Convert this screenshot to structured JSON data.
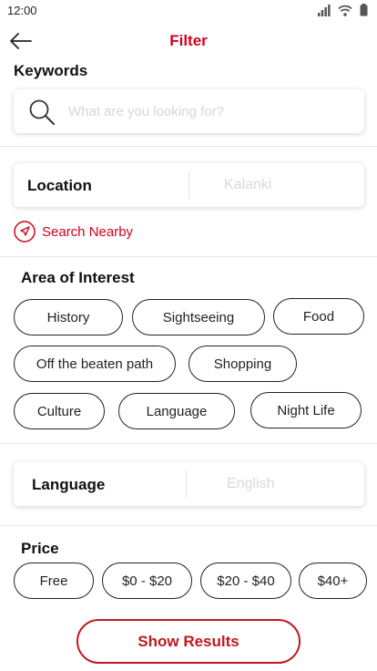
{
  "status_bar": {
    "time": "12:00"
  },
  "header": {
    "title": "Filter"
  },
  "keywords": {
    "label": "Keywords",
    "value": "",
    "placeholder": "What are you looking for?"
  },
  "location": {
    "label": "Location",
    "value": "Kalanki"
  },
  "search_nearby": {
    "label": "Search Nearby"
  },
  "area_of_interest": {
    "label": "Area of Interest",
    "chips": [
      {
        "label": "History"
      },
      {
        "label": "Sightseeing"
      },
      {
        "label": "Food"
      },
      {
        "label": "Off the beaten path"
      },
      {
        "label": "Shopping"
      },
      {
        "label": "Culture"
      },
      {
        "label": "Language"
      },
      {
        "label": "Night Life"
      }
    ]
  },
  "language": {
    "label": "Language",
    "value": "English"
  },
  "price": {
    "label": "Price",
    "options": [
      {
        "label": "Free"
      },
      {
        "label": "$0 - $20"
      },
      {
        "label": "$20 - $40"
      },
      {
        "label": "$40+"
      }
    ]
  },
  "actions": {
    "show_results": "Show Results"
  },
  "colors": {
    "accent": "#d0021b",
    "chip_border": "#222222",
    "placeholder": "#d6d6d6"
  }
}
